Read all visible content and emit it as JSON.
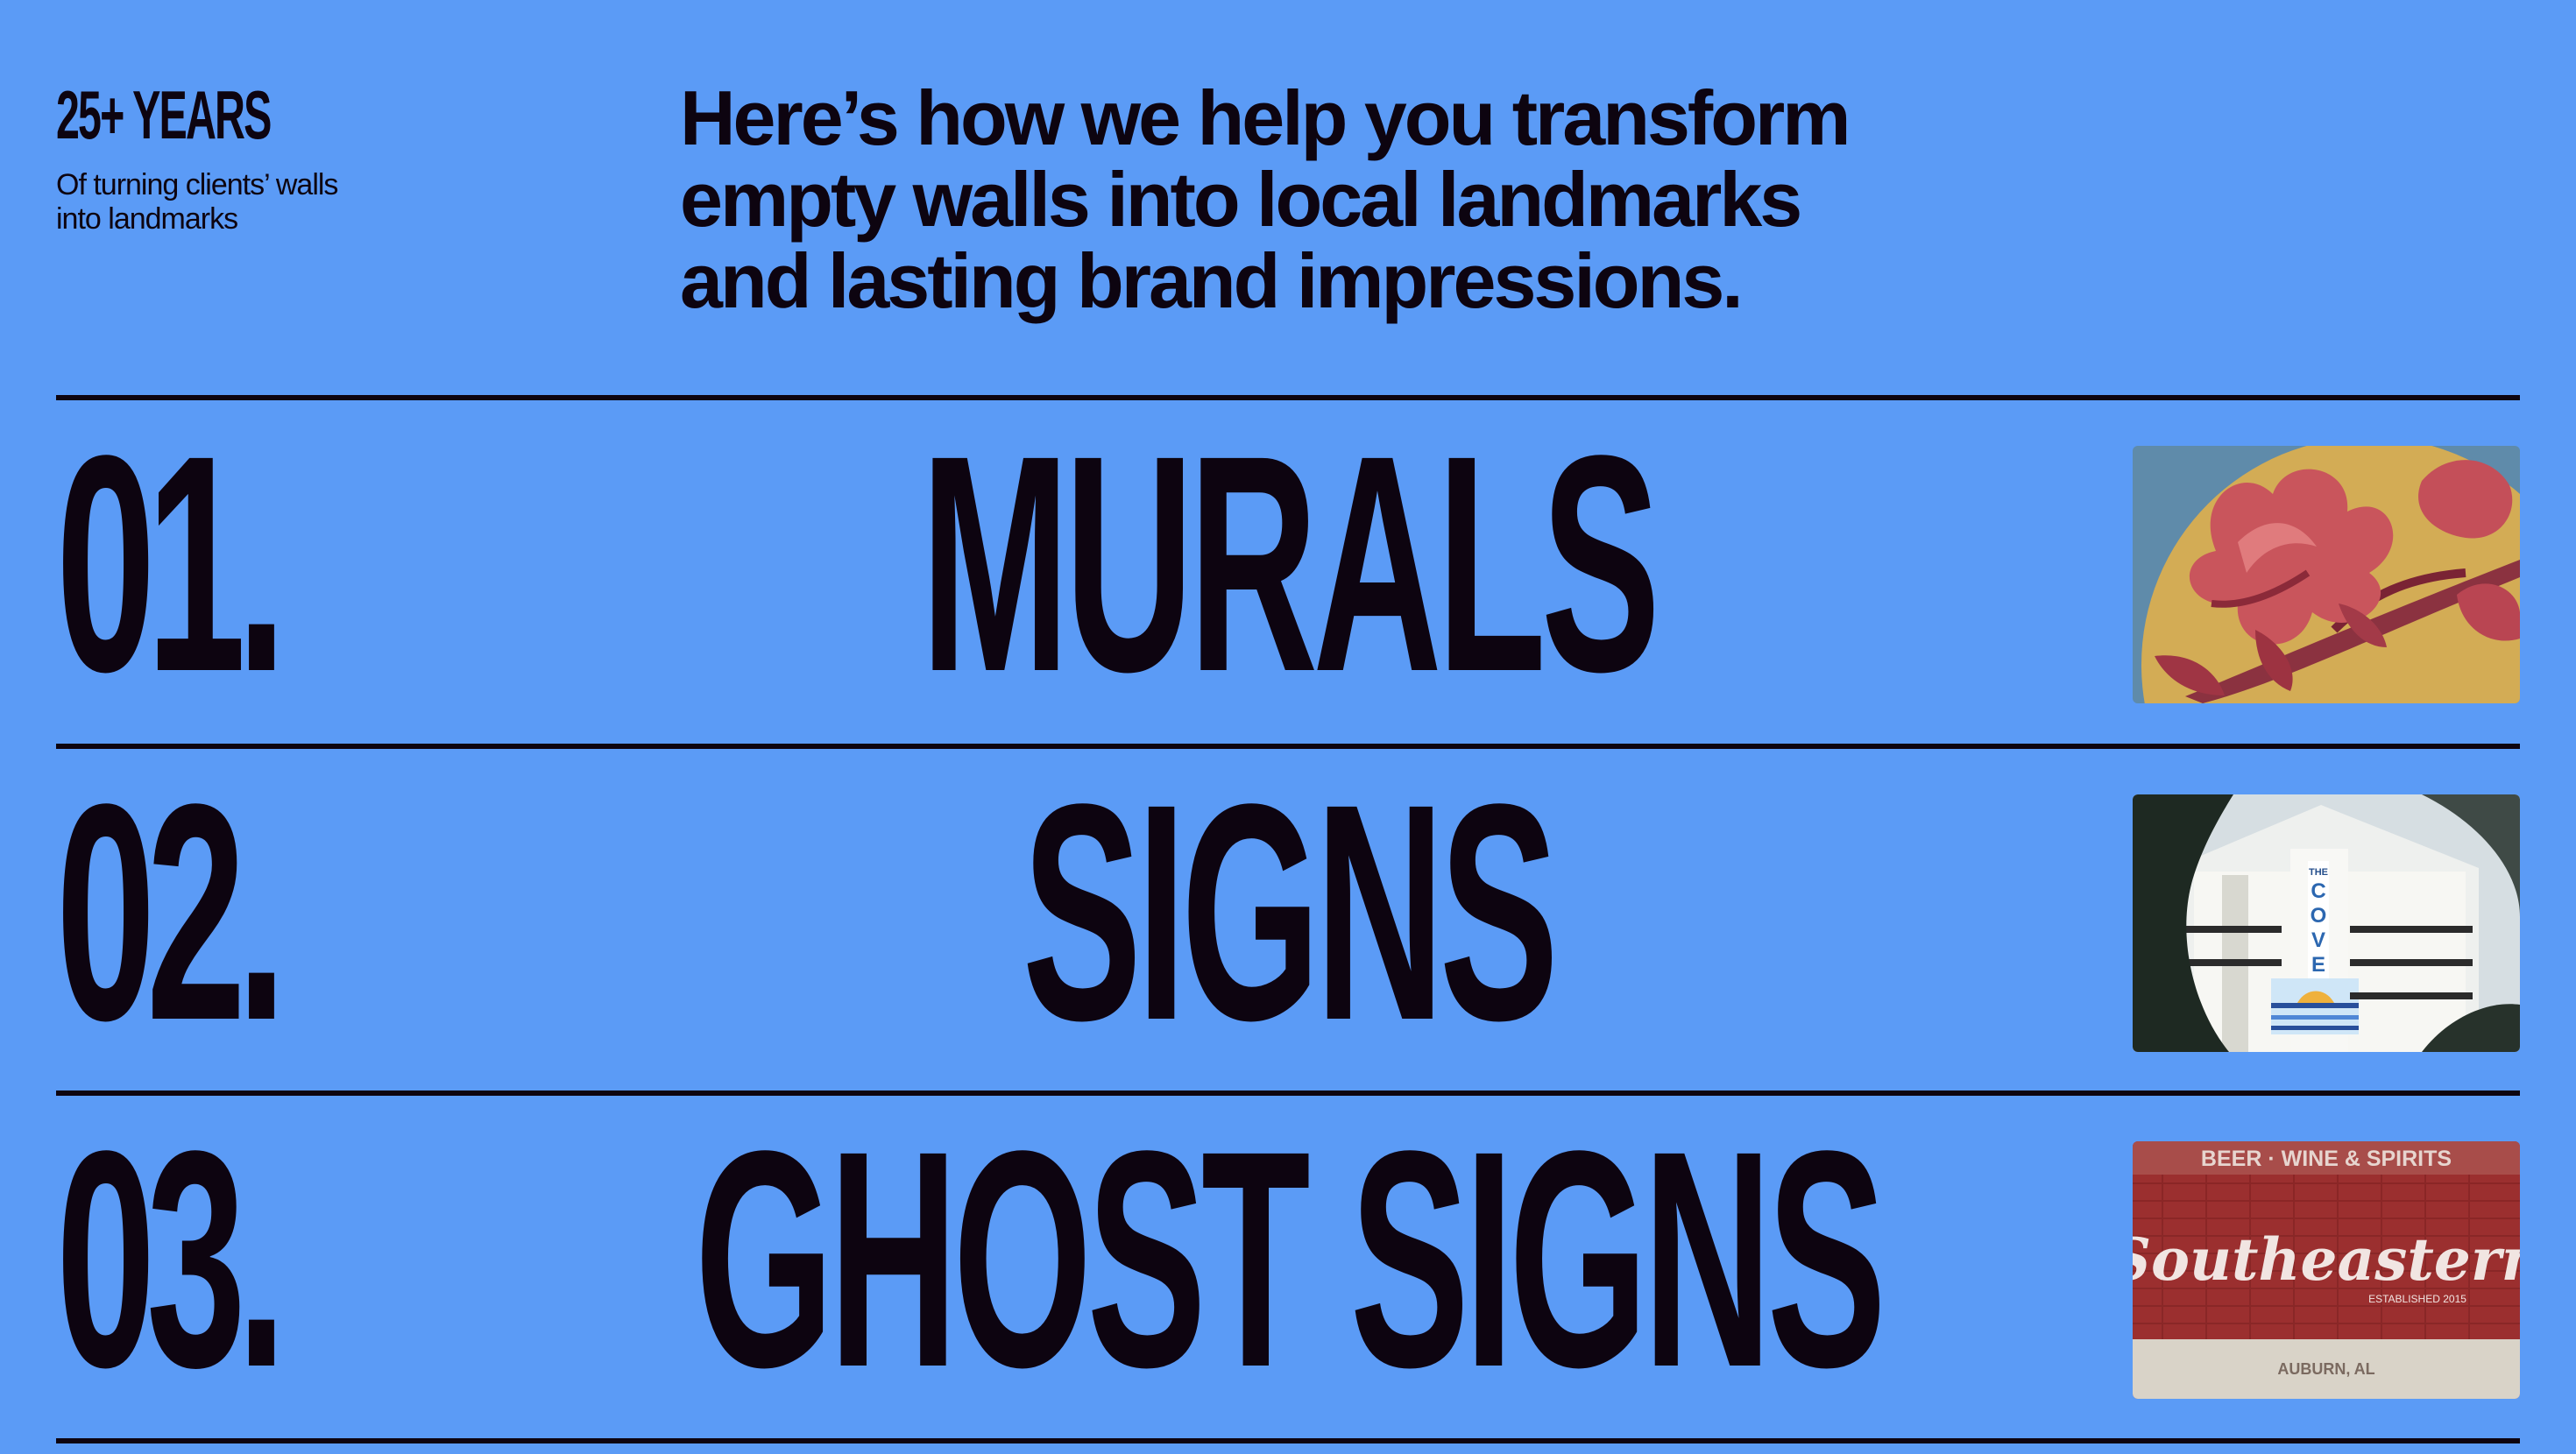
{
  "stat": {
    "value": "25+ YEARS",
    "caption": "Of turning clients’ walls into landmarks"
  },
  "intro": {
    "text": "Here’s how we help you transform\nempty walls into local landmarks\nand lasting brand impressions."
  },
  "services": [
    {
      "number": "01.",
      "title": "MURALS",
      "image": "magnolia-mural-photo"
    },
    {
      "number": "02.",
      "title": "SIGNS",
      "image": "the-cove-building-sign-photo",
      "image_text": "THE COVE"
    },
    {
      "number": "03.",
      "title": "GHOST SIGNS",
      "image": "southeastern-ghost-sign-photo",
      "image_text": {
        "top": "BEER · WINE & SPIRITS",
        "script": "Southeastern",
        "established": "ESTABLISHED 2015",
        "bottom": "AUBURN, AL"
      }
    }
  ],
  "colors": {
    "background": "#5b9bf6",
    "ink": "#0d0410"
  }
}
